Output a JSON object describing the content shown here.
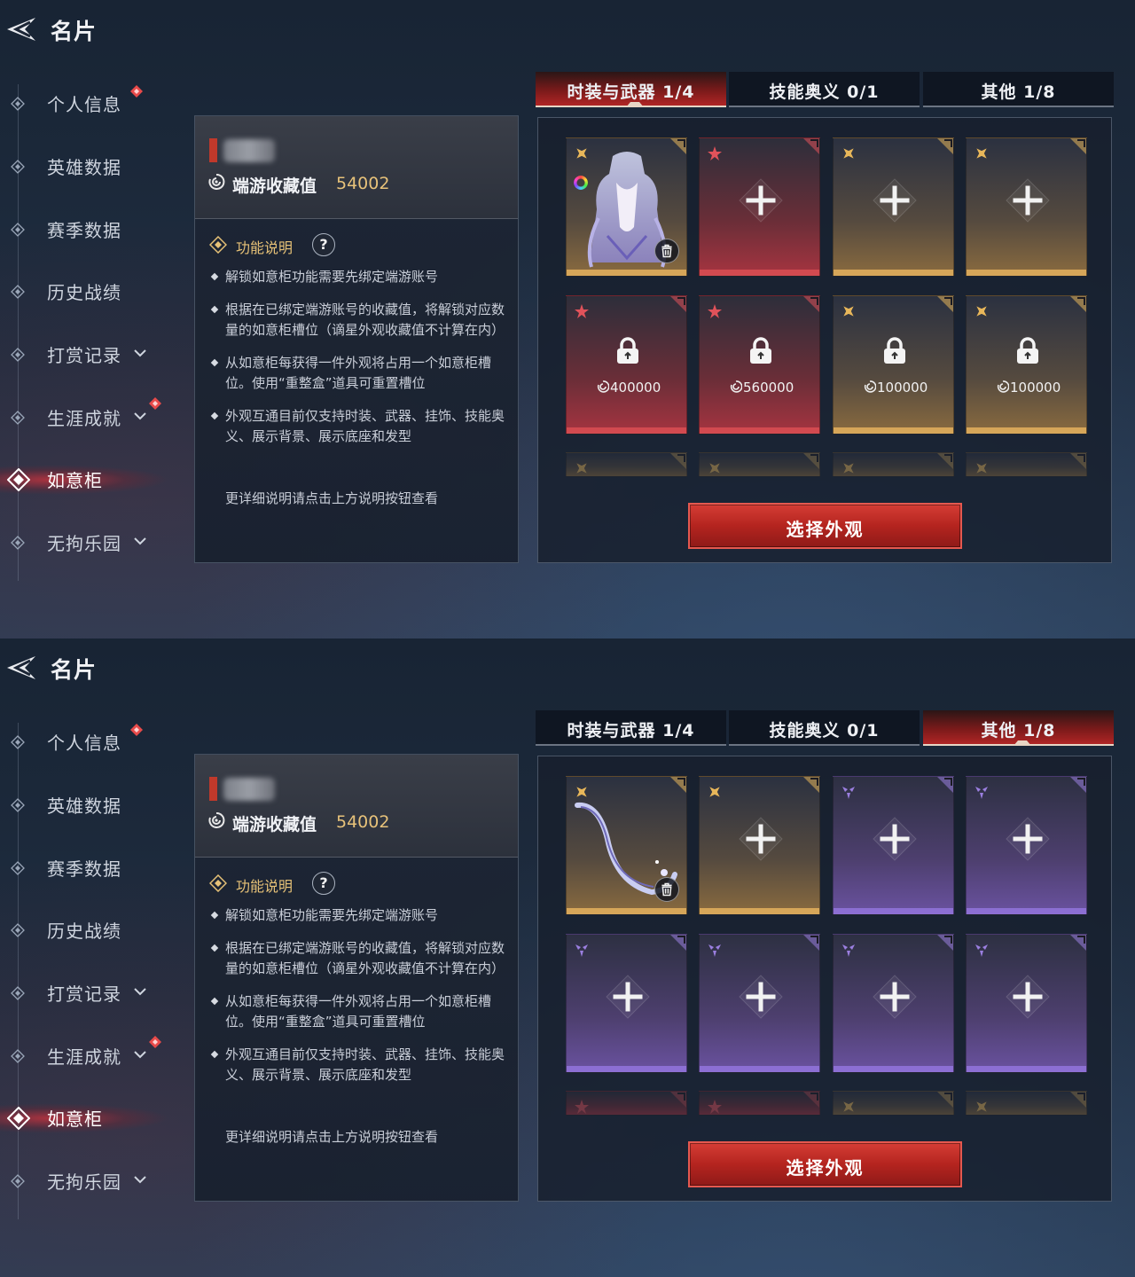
{
  "colors": {
    "accent_red": "#c0392b",
    "gold": "#e7c27a",
    "tab_active": "#b02525",
    "slot_gold": "#d6a659",
    "slot_red": "#d24a50",
    "slot_purple": "#8c6fd3"
  },
  "screens": [
    {
      "header": {
        "title": "名片",
        "back_icon": "back-arrow-icon"
      },
      "sidebar": {
        "items": [
          {
            "label": "个人信息",
            "badge": true,
            "expand": false,
            "active": false
          },
          {
            "label": "英雄数据",
            "badge": false,
            "expand": false,
            "active": false
          },
          {
            "label": "赛季数据",
            "badge": false,
            "expand": false,
            "active": false
          },
          {
            "label": "历史战绩",
            "badge": false,
            "expand": false,
            "active": false
          },
          {
            "label": "打赏记录",
            "badge": false,
            "expand": true,
            "active": false
          },
          {
            "label": "生涯成就",
            "badge": true,
            "expand": true,
            "active": false
          },
          {
            "label": "如意柜",
            "badge": false,
            "expand": false,
            "active": true
          },
          {
            "label": "无拘乐园",
            "badge": false,
            "expand": true,
            "active": false
          }
        ]
      },
      "info": {
        "collection_label": "端游收藏值",
        "collection_value": "54002",
        "func_title": "功能说明",
        "help": "?",
        "bullets": [
          "解锁如意柜功能需要先绑定端游账号",
          "根据在已绑定端游账号的收藏值，将解锁对应数量的如意柜槽位（谪星外观收藏值不计算在内）",
          "从如意柜每获得一件外观将占用一个如意柜槽位。使用“重整盒”道具可重置槽位",
          "外观互通目前仅支持时装、武器、挂饰、技能奥义、展示背景、展示底座和发型"
        ],
        "more": "更详细说明请点击上方说明按钮查看"
      },
      "tabs": [
        {
          "label": "时装与武器  1/4",
          "active": true
        },
        {
          "label": "技能奥义  0/1",
          "active": false
        },
        {
          "label": "其他  1/8",
          "active": false
        }
      ],
      "slots": [
        {
          "tier": "gold",
          "state": "filled",
          "item": "outfit"
        },
        {
          "tier": "red",
          "state": "empty"
        },
        {
          "tier": "gold",
          "state": "empty"
        },
        {
          "tier": "gold",
          "state": "empty"
        },
        {
          "tier": "red",
          "state": "locked",
          "cost": "400000"
        },
        {
          "tier": "red",
          "state": "locked",
          "cost": "560000"
        },
        {
          "tier": "gold",
          "state": "locked",
          "cost": "100000"
        },
        {
          "tier": "gold",
          "state": "locked",
          "cost": "100000"
        },
        {
          "tier": "gold",
          "state": "partial"
        },
        {
          "tier": "gold",
          "state": "partial"
        },
        {
          "tier": "gold",
          "state": "partial"
        },
        {
          "tier": "gold",
          "state": "partial"
        }
      ],
      "button": "选择外观"
    },
    {
      "header": {
        "title": "名片",
        "back_icon": "back-arrow-icon"
      },
      "sidebar": {
        "items": [
          {
            "label": "个人信息",
            "badge": true,
            "expand": false,
            "active": false
          },
          {
            "label": "英雄数据",
            "badge": false,
            "expand": false,
            "active": false
          },
          {
            "label": "赛季数据",
            "badge": false,
            "expand": false,
            "active": false
          },
          {
            "label": "历史战绩",
            "badge": false,
            "expand": false,
            "active": false
          },
          {
            "label": "打赏记录",
            "badge": false,
            "expand": true,
            "active": false
          },
          {
            "label": "生涯成就",
            "badge": true,
            "expand": true,
            "active": false
          },
          {
            "label": "如意柜",
            "badge": false,
            "expand": false,
            "active": true
          },
          {
            "label": "无拘乐园",
            "badge": false,
            "expand": true,
            "active": false
          }
        ]
      },
      "info": {
        "collection_label": "端游收藏值",
        "collection_value": "54002",
        "func_title": "功能说明",
        "help": "?",
        "bullets": [
          "解锁如意柜功能需要先绑定端游账号",
          "根据在已绑定端游账号的收藏值，将解锁对应数量的如意柜槽位（谪星外观收藏值不计算在内）",
          "从如意柜每获得一件外观将占用一个如意柜槽位。使用“重整盒”道具可重置槽位",
          "外观互通目前仅支持时装、武器、挂饰、技能奥义、展示背景、展示底座和发型"
        ],
        "more": "更详细说明请点击上方说明按钮查看"
      },
      "tabs": [
        {
          "label": "时装与武器  1/4",
          "active": false
        },
        {
          "label": "技能奥义  0/1",
          "active": false
        },
        {
          "label": "其他  1/8",
          "active": true
        }
      ],
      "slots": [
        {
          "tier": "gold",
          "state": "filled",
          "item": "accessory"
        },
        {
          "tier": "gold",
          "state": "empty"
        },
        {
          "tier": "purple",
          "state": "empty"
        },
        {
          "tier": "purple",
          "state": "empty"
        },
        {
          "tier": "purple",
          "state": "empty"
        },
        {
          "tier": "purple",
          "state": "empty"
        },
        {
          "tier": "purple",
          "state": "empty"
        },
        {
          "tier": "purple",
          "state": "empty"
        },
        {
          "tier": "red",
          "state": "partial"
        },
        {
          "tier": "red",
          "state": "partial"
        },
        {
          "tier": "gold",
          "state": "partial"
        },
        {
          "tier": "gold",
          "state": "partial"
        }
      ],
      "button": "选择外观"
    }
  ]
}
